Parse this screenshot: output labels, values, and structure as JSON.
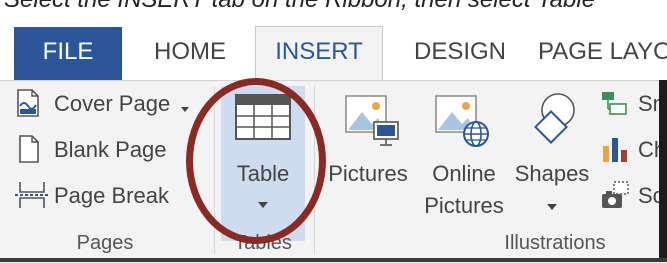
{
  "caption": {
    "text": "Select the INSERT tab on the Ribbon, then select Table"
  },
  "tabs": {
    "file": "FILE",
    "home": "HOME",
    "insert": "INSERT",
    "design": "DESIGN",
    "page_layout": "PAGE LAYO"
  },
  "pages_group": {
    "cover_page": "Cover Page",
    "blank_page": "Blank Page",
    "page_break": "Page Break",
    "label": "Pages"
  },
  "tables_group": {
    "table": "Table",
    "label": "Tables"
  },
  "illustrations_group": {
    "pictures": "Pictures",
    "online_pictures_line1": "Online",
    "online_pictures_line2": "Pictures",
    "shapes": "Shapes",
    "smartart_partial": "Sm",
    "chart_partial": "Ch",
    "screenshot_partial": "Scr",
    "label": "Illustrations"
  },
  "colors": {
    "file_tab": "#2b579a",
    "selected_button": "#cfdbee",
    "annotation_circle": "#8b2a24"
  },
  "icons": {
    "cover_page": "cover-page-icon",
    "blank_page": "blank-page-icon",
    "page_break": "page-break-icon",
    "table": "table-grid-icon",
    "pictures": "pictures-icon",
    "online_pictures": "online-pictures-icon",
    "shapes": "shapes-icon",
    "smartart": "smartart-icon",
    "chart": "chart-icon",
    "screenshot": "screenshot-icon"
  }
}
